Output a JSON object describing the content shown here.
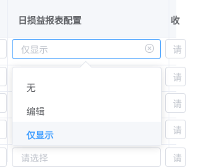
{
  "table": {
    "columns": [
      {
        "label": "日损益报表配置"
      },
      {
        "label": "收"
      }
    ]
  },
  "active_select": {
    "placeholder": "仅显示"
  },
  "cells": {
    "placeholder": "请",
    "placeholder_full": "请选择"
  },
  "dropdown": {
    "options": [
      {
        "label": "无",
        "selected": false
      },
      {
        "label": "编辑",
        "selected": false
      },
      {
        "label": "仅显示",
        "selected": true
      }
    ]
  },
  "colors": {
    "accent": "#409eff",
    "border": "#dcdfe6",
    "placeholder": "#c0c4cc",
    "header_bg": "#f5f7fa"
  }
}
